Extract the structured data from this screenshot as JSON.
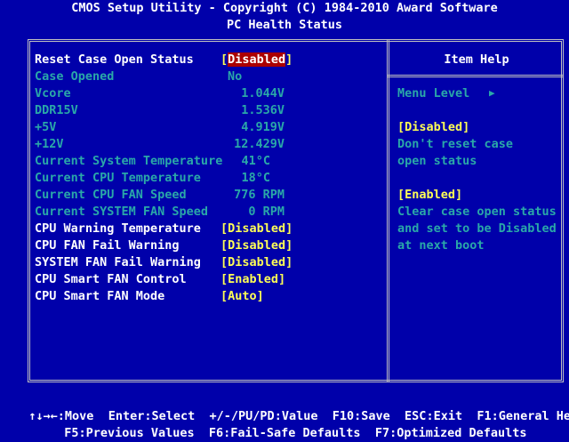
{
  "header": {
    "title": "CMOS Setup Utility - Copyright (C) 1984-2010 Award Software",
    "subtitle": "PC Health Status"
  },
  "items": [
    {
      "label": "Reset Case Open Status",
      "value": "Disabled",
      "editable": true,
      "selected": true
    },
    {
      "label": "Case Opened",
      "value": "No",
      "editable": false
    },
    {
      "label": "Vcore",
      "value": "1.044V",
      "editable": false
    },
    {
      "label": "DDR15V",
      "value": "1.536V",
      "editable": false
    },
    {
      "label": "+5V",
      "value": "4.919V",
      "editable": false
    },
    {
      "label": "+12V",
      "value": "12.429V",
      "editable": false
    },
    {
      "label": "Current System Temperature",
      "value": "41°C",
      "editable": false
    },
    {
      "label": "Current CPU Temperature",
      "value": "18°C",
      "editable": false
    },
    {
      "label": "Current CPU FAN Speed",
      "value": "776 RPM",
      "editable": false
    },
    {
      "label": "Current SYSTEM FAN Speed",
      "value": "0 RPM",
      "editable": false
    },
    {
      "label": "CPU Warning Temperature",
      "value": "Disabled",
      "editable": true
    },
    {
      "label": "CPU FAN Fail Warning",
      "value": "Disabled",
      "editable": true
    },
    {
      "label": "SYSTEM FAN Fail Warning",
      "value": "Disabled",
      "editable": true
    },
    {
      "label": "CPU Smart FAN Control",
      "value": "Enabled",
      "editable": true
    },
    {
      "label": "CPU Smart FAN Mode",
      "value": "Auto",
      "editable": true
    }
  ],
  "help": {
    "title": "Item Help",
    "menu_level": "Menu Level",
    "menu_level_arrow": "▶",
    "opt1_title": "[Disabled]",
    "opt1_lines": [
      "Don't reset case",
      "open status"
    ],
    "opt2_title": "[Enabled]",
    "opt2_lines": [
      "Clear case open status",
      "and set to be Disabled",
      "at next boot"
    ]
  },
  "footer": {
    "line1": [
      {
        "key": "↑↓→←",
        "action": "Move"
      },
      {
        "key": "Enter",
        "action": "Select"
      },
      {
        "key": "+/-/PU/PD",
        "action": "Value"
      },
      {
        "key": "F10",
        "action": "Save"
      },
      {
        "key": "ESC",
        "action": "Exit"
      },
      {
        "key": "F1",
        "action": "General Help"
      }
    ],
    "line2": [
      {
        "key": "F5",
        "action": "Previous Values"
      },
      {
        "key": "F6",
        "action": "Fail-Safe Defaults"
      },
      {
        "key": "F7",
        "action": "Optimized Defaults"
      }
    ]
  },
  "colors": {
    "background": "#0000aa",
    "dim_text": "#2aa8a8",
    "value_text": "#ffff55",
    "highlight": "#aa0000",
    "text": "#ffffff"
  }
}
